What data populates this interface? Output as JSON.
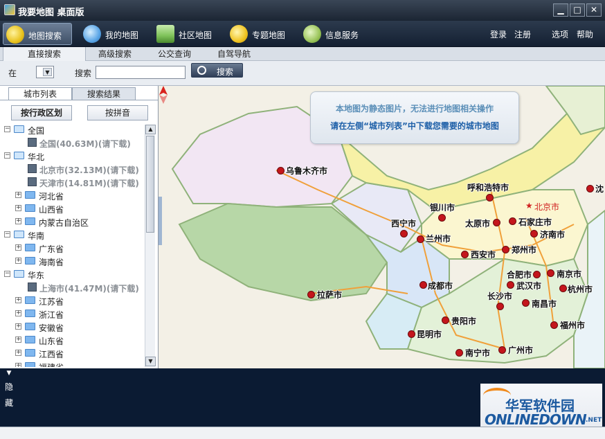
{
  "window": {
    "title": "我要地图  桌面版",
    "min_label": "▁",
    "max_label": "□",
    "close_label": "✕"
  },
  "nav": {
    "tabs": [
      {
        "label": "地图搜索",
        "icon": "map-search-icon",
        "color": "#e8c21c"
      },
      {
        "label": "我的地图",
        "icon": "user-group-icon",
        "color": "#5aa5e6"
      },
      {
        "label": "社区地图",
        "icon": "buildings-icon",
        "color": "#7fc25a"
      },
      {
        "label": "专题地图",
        "icon": "e-globe-icon",
        "color": "#f0c320"
      },
      {
        "label": "信息服务",
        "icon": "info-service-icon",
        "color": "#9ac45a"
      }
    ],
    "links": [
      "登录",
      "注册",
      "选项",
      "帮助"
    ]
  },
  "subtabs": [
    "直接搜索",
    "高级搜索",
    "公交查询",
    "自驾导航"
  ],
  "search": {
    "in_label": "在",
    "region_value": "",
    "search_label": "搜索",
    "input_value": "",
    "button_label": "搜索"
  },
  "left": {
    "tabs": [
      "城市列表",
      "搜索结果"
    ],
    "buttons": [
      "按行政区划",
      "按拼音"
    ],
    "tree": [
      {
        "type": "region",
        "label": "全国",
        "expanded": true
      },
      {
        "type": "city",
        "label": "全国(40.63M)(请下载)"
      },
      {
        "type": "region",
        "label": "华北",
        "expanded": true
      },
      {
        "type": "city",
        "label": "北京市(32.13M)(请下载)"
      },
      {
        "type": "city",
        "label": "天津市(14.81M)(请下载)"
      },
      {
        "type": "province",
        "label": "河北省"
      },
      {
        "type": "province",
        "label": "山西省"
      },
      {
        "type": "province",
        "label": "内蒙古自治区"
      },
      {
        "type": "region",
        "label": "华南",
        "expanded": true
      },
      {
        "type": "province",
        "label": "广东省"
      },
      {
        "type": "province",
        "label": "海南省"
      },
      {
        "type": "region",
        "label": "华东",
        "expanded": true
      },
      {
        "type": "city",
        "label": "上海市(41.47M)(请下载)"
      },
      {
        "type": "province",
        "label": "江苏省"
      },
      {
        "type": "province",
        "label": "浙江省"
      },
      {
        "type": "province",
        "label": "安徽省"
      },
      {
        "type": "province",
        "label": "山东省"
      },
      {
        "type": "province",
        "label": "江西省"
      },
      {
        "type": "province",
        "label": "福建省"
      }
    ]
  },
  "map": {
    "callout_line1": "本地图为静态图片，无法进行地图相关操作",
    "callout_line2": "请在左侧“城市列表”中下载您需要的城市地图",
    "capital": "北京市",
    "cities": [
      "乌鲁木齐市",
      "呼和浩特市",
      "银川市",
      "西宁市",
      "兰州市",
      "太原市",
      "石家庄市",
      "济南市",
      "西安市",
      "郑州市",
      "合肥市",
      "南京市",
      "武汉市",
      "杭州市",
      "成都市",
      "拉萨市",
      "长沙市",
      "南昌市",
      "贵阳市",
      "福州市",
      "昆明市",
      "南宁市",
      "广州市",
      "沈"
    ],
    "colors": {
      "city_dot": "#c4161c",
      "capital": "#d0201f"
    }
  },
  "bottom": {
    "hide_chars": [
      "隐",
      "藏"
    ],
    "logo_cn": "华军软件园",
    "logo_en": "ONLINEDOWN",
    "logo_net": ".NET"
  }
}
